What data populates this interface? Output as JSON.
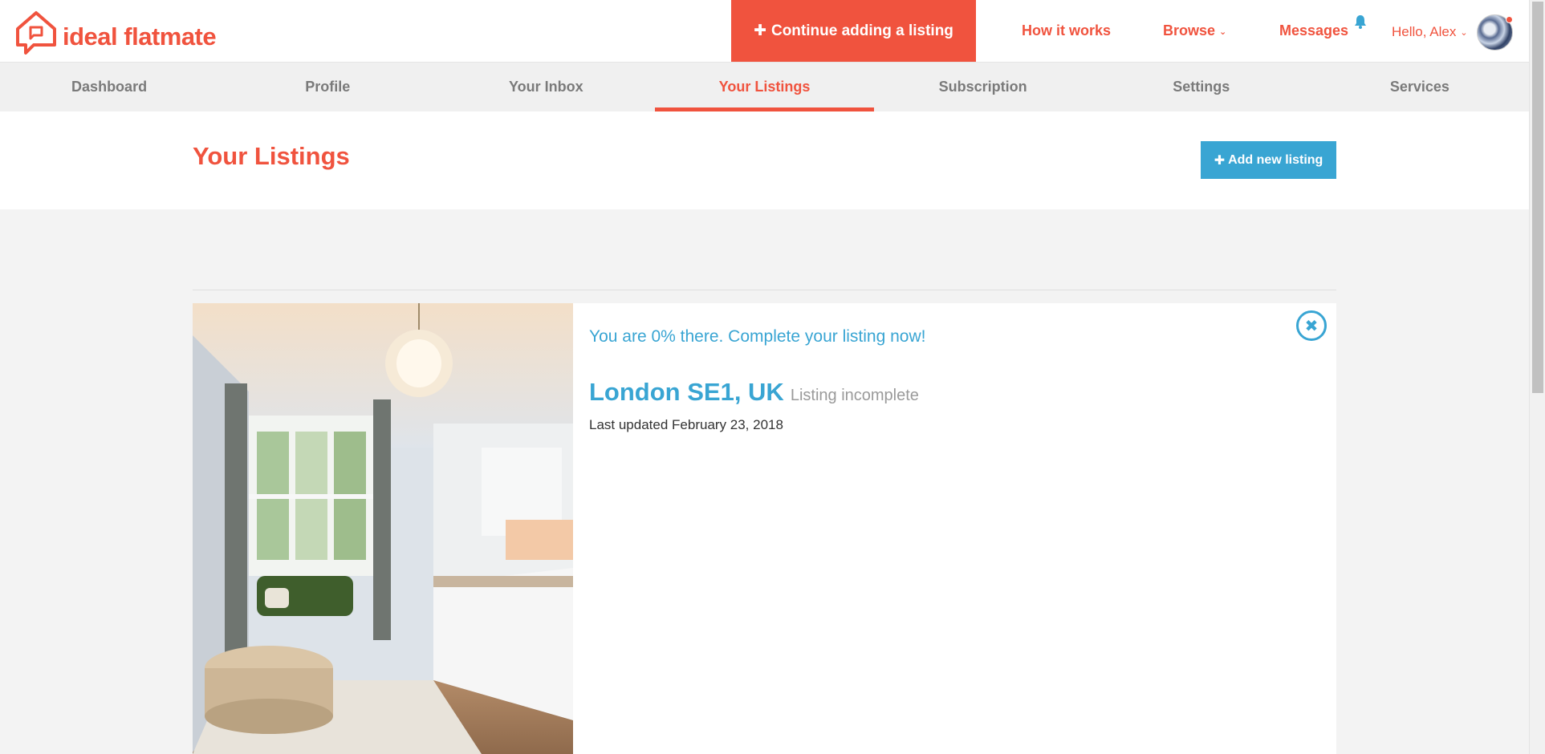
{
  "brand": {
    "name": "ideal flatmate",
    "color": "#f0533e",
    "accent": "#39a5d3"
  },
  "header": {
    "continue_label": "Continue adding a listing",
    "how_it_works": "How it works",
    "browse": "Browse",
    "messages": "Messages",
    "greeting": "Hello, Alex"
  },
  "subnav": {
    "items": [
      "Dashboard",
      "Profile",
      "Your Inbox",
      "Your Listings",
      "Subscription",
      "Settings",
      "Services"
    ],
    "active": "Your Listings"
  },
  "page": {
    "title": "Your Listings",
    "add_label": "Add new listing"
  },
  "listing": {
    "progress": "You are 0% there. Complete your listing now!",
    "progress_percent": 0,
    "location": "London SE1, UK",
    "status": "Listing incomplete",
    "updated": "Last updated February 23, 2018",
    "close_symbol": "✖"
  },
  "icons": [
    "plus-icon",
    "chevron-down-icon",
    "bell-icon",
    "close-icon",
    "house-chat-logo"
  ]
}
